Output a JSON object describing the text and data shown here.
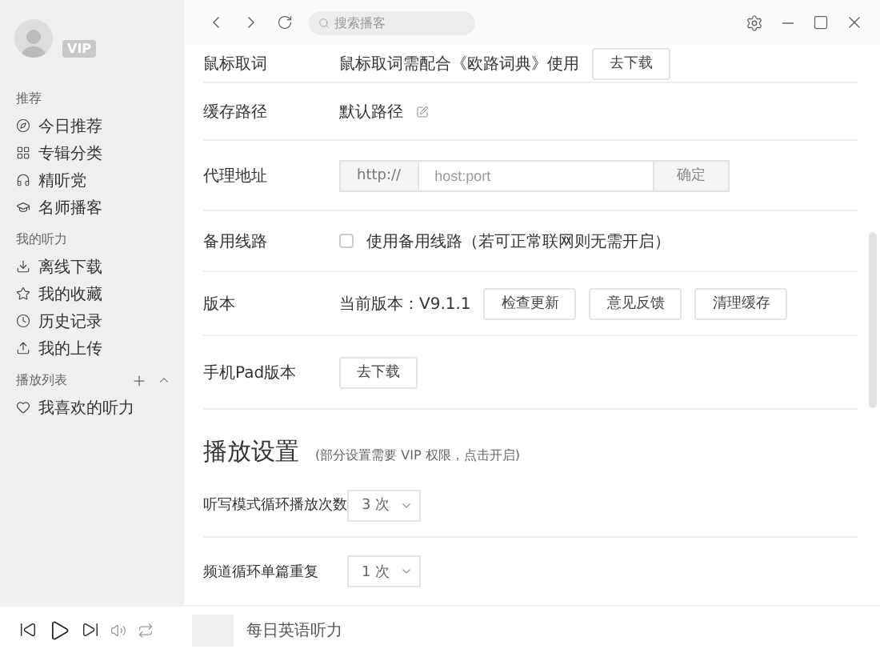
{
  "sidebar": {
    "vip_badge": "VIP",
    "sections": [
      {
        "title": "推荐",
        "kind": "plain",
        "items": [
          {
            "label": "今日推荐",
            "kind": "compass"
          },
          {
            "label": "专辑分类",
            "kind": "grid"
          },
          {
            "label": "精听党",
            "kind": "headphones"
          },
          {
            "label": "名师播客",
            "kind": "cap"
          }
        ]
      },
      {
        "title": "我的听力",
        "kind": "plain",
        "items": [
          {
            "label": "离线下载",
            "kind": "download"
          },
          {
            "label": "我的收藏",
            "kind": "star"
          },
          {
            "label": "历史记录",
            "kind": "clock"
          },
          {
            "label": "我的上传",
            "kind": "upload"
          }
        ]
      },
      {
        "title": "播放列表",
        "kind": "playlist",
        "items": [
          {
            "label": "我喜欢的听力",
            "kind": "heart"
          }
        ]
      }
    ]
  },
  "toolbar": {
    "search": {
      "placeholder": "搜索播客"
    }
  },
  "settings": [
    {
      "kind": "text_button",
      "label": "鼠标取词",
      "text": "鼠标取词需配合《欧路词典》使用",
      "buttons": [
        "去下载"
      ]
    },
    {
      "kind": "path",
      "label": "缓存路径",
      "text": "默认路径"
    },
    {
      "kind": "proxy",
      "label": "代理地址",
      "prefix": "http://",
      "placeholder": "host:port",
      "buttons": [
        "确定"
      ]
    },
    {
      "kind": "checkbox",
      "label": "备用线路",
      "text": "使用备用线路（若可正常联网则无需开启）",
      "checked": false
    },
    {
      "kind": "text_button",
      "label": "版本",
      "text": "当前版本：V9.1.1",
      "buttons": [
        "检查更新",
        "意见反馈",
        "清理缓存"
      ]
    },
    {
      "kind": "text_button",
      "label": "手机Pad版本",
      "buttons": [
        "去下载"
      ]
    }
  ],
  "play_settings": {
    "title": "播放设置",
    "note": "(部分设置需要 VIP 权限，点击开启)",
    "rows": [
      {
        "label": "听写模式循环播放次数",
        "value": "3 次"
      },
      {
        "label": "频道循环单篇重复",
        "value": "1 次"
      }
    ]
  },
  "player": {
    "track": "每日英语听力"
  }
}
